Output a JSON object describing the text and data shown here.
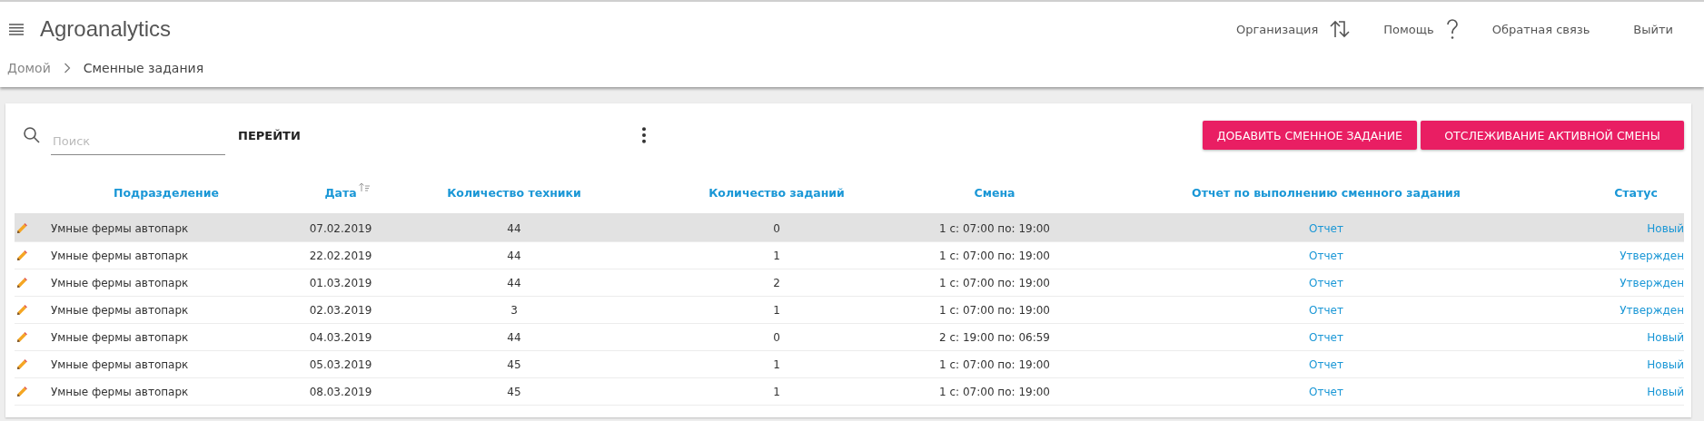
{
  "header": {
    "title": "Agroanalytics",
    "nav": [
      {
        "label": "Организация",
        "kind": "org"
      },
      {
        "label": "Помощь",
        "kind": "help"
      },
      {
        "label": "Обратная связь",
        "kind": "plain"
      },
      {
        "label": "Выйти",
        "kind": "plain"
      }
    ]
  },
  "breadcrumb": [
    "Домой",
    "Сменные задания"
  ],
  "toolbar": {
    "search": {
      "placeholder": "Поиск"
    },
    "go_button": "ПЕРЕЙТИ",
    "buttons": [
      "ДОБАВИТЬ СМЕННОЕ ЗАДАНИЕ",
      "ОТСЛЕЖИВАНИЕ АКТИВНОЙ СМЕНЫ"
    ]
  },
  "table": {
    "columns": [
      {
        "label": "Подразделение",
        "sorted": false
      },
      {
        "label": "Дата",
        "sorted": true
      },
      {
        "label": "Количество техники",
        "sorted": false
      },
      {
        "label": "Количество заданий",
        "sorted": false
      },
      {
        "label": "Смена",
        "sorted": false
      },
      {
        "label": "Отчет по выполнению сменного задания",
        "sorted": false
      },
      {
        "label": "Статус",
        "sorted": false
      }
    ],
    "rows": [
      {
        "selected": true,
        "cells": [
          "Умные фермы автопарк",
          "07.02.2019",
          "44",
          "0",
          "1 с: 07:00 по: 19:00",
          "Отчет",
          "Новый"
        ]
      },
      {
        "selected": false,
        "cells": [
          "Умные фермы автопарк",
          "22.02.2019",
          "44",
          "1",
          "1 с: 07:00 по: 19:00",
          "Отчет",
          "Утвержден"
        ]
      },
      {
        "selected": false,
        "cells": [
          "Умные фермы автопарк",
          "01.03.2019",
          "44",
          "2",
          "1 с: 07:00 по: 19:00",
          "Отчет",
          "Утвержден"
        ]
      },
      {
        "selected": false,
        "cells": [
          "Умные фермы автопарк",
          "02.03.2019",
          "3",
          "1",
          "1 с: 07:00 по: 19:00",
          "Отчет",
          "Утвержден"
        ]
      },
      {
        "selected": false,
        "cells": [
          "Умные фермы автопарк",
          "04.03.2019",
          "44",
          "0",
          "2 с: 19:00 по: 06:59",
          "Отчет",
          "Новый"
        ]
      },
      {
        "selected": false,
        "cells": [
          "Умные фермы автопарк",
          "05.03.2019",
          "45",
          "1",
          "1 с: 07:00 по: 19:00",
          "Отчет",
          "Новый"
        ]
      },
      {
        "selected": false,
        "cells": [
          "Умные фермы автопарк",
          "08.03.2019",
          "45",
          "1",
          "1 с: 07:00 по: 19:00",
          "Отчет",
          "Новый"
        ]
      }
    ]
  }
}
